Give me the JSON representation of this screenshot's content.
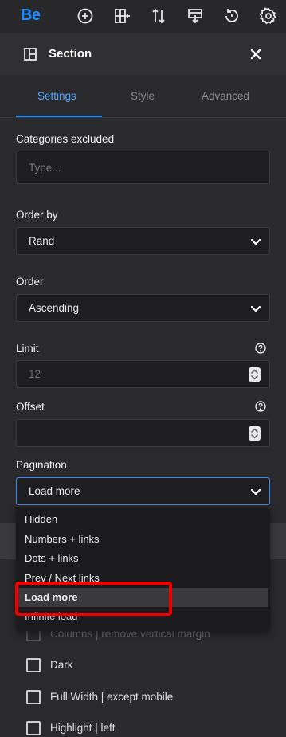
{
  "toolbar": {
    "logo": "Be",
    "icons": [
      "add-circle-icon",
      "layout-add-icon",
      "sort-icon",
      "export-icon",
      "history-icon",
      "settings-gear-icon"
    ]
  },
  "section_header": {
    "title": "Section",
    "icon": "section-layout-icon",
    "close_icon": "close-icon"
  },
  "tabs": [
    {
      "label": "Settings",
      "active": true
    },
    {
      "label": "Style",
      "active": false
    },
    {
      "label": "Advanced",
      "active": false
    }
  ],
  "form": {
    "categories_excluded": {
      "label": "Categories excluded",
      "placeholder": "Type..."
    },
    "order_by": {
      "label": "Order by",
      "value": "Rand"
    },
    "order": {
      "label": "Order",
      "value": "Ascending"
    },
    "limit": {
      "label": "Limit",
      "value": "12"
    },
    "offset": {
      "label": "Offset",
      "value": ""
    },
    "pagination": {
      "label": "Pagination",
      "value": "Load more",
      "options": [
        "Hidden",
        "Numbers + links",
        "Dots + links",
        "Prev / Next links",
        "Load more",
        "Infinite load"
      ],
      "highlighted": "Load more"
    }
  },
  "checkboxes": [
    {
      "label": "Columns | remove vertical margin",
      "checked": false
    },
    {
      "label": "Dark",
      "checked": false
    },
    {
      "label": "Full Width | except mobile",
      "checked": false
    },
    {
      "label": "Highlight | left",
      "checked": false
    }
  ],
  "colors": {
    "accent": "#1e8bff",
    "background": "#2a2a2d",
    "field": "#1e1e21",
    "highlight_box": "#ee0000"
  }
}
